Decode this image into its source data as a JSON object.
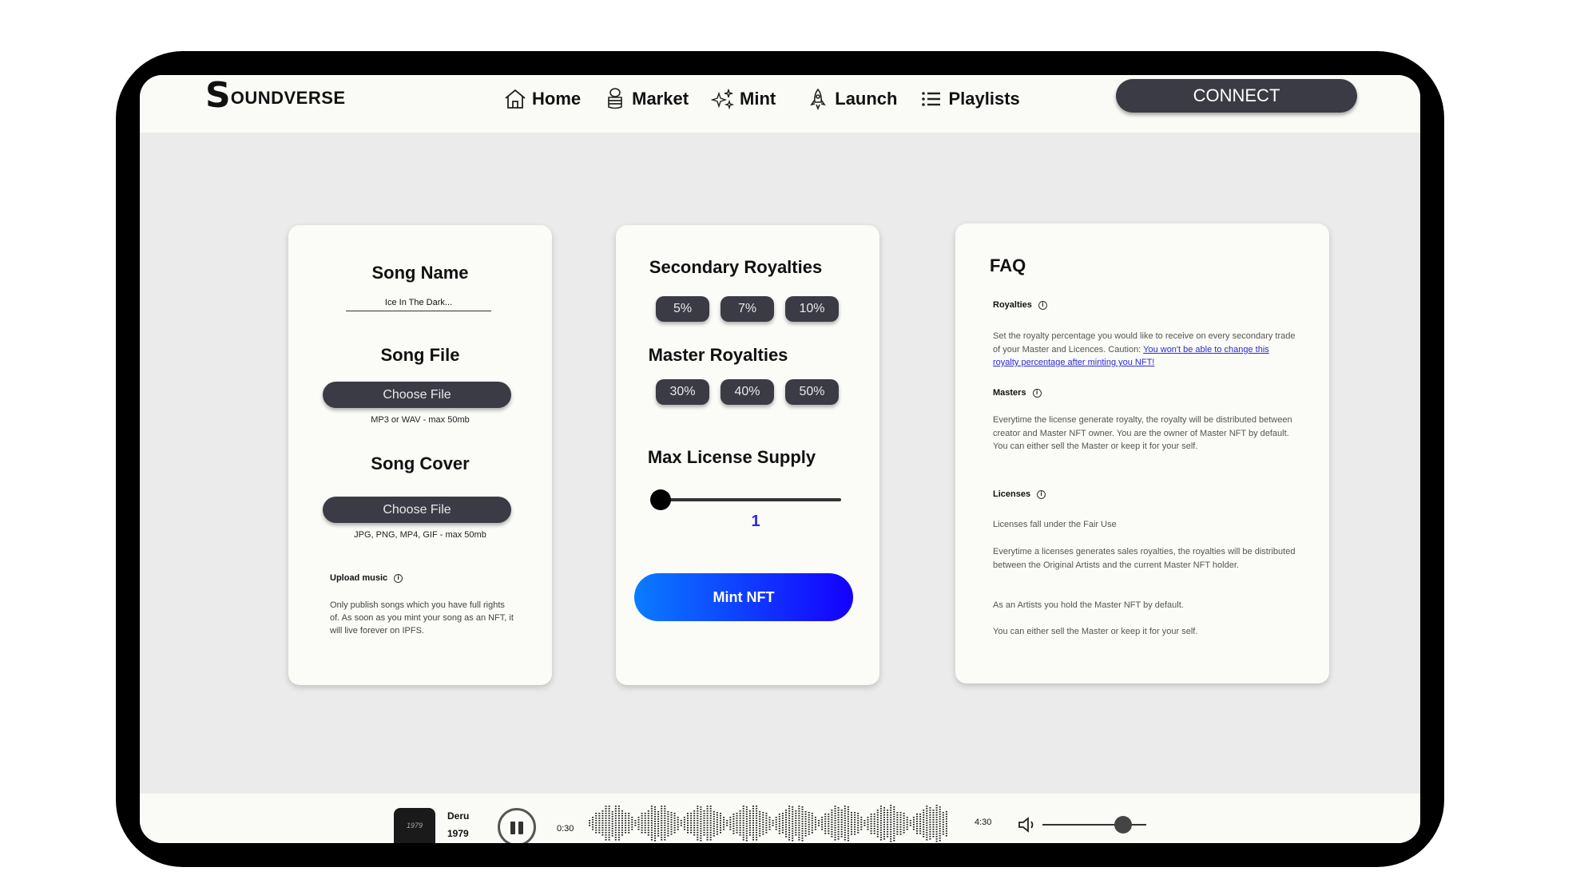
{
  "app": {
    "logo_s": "S",
    "logo_text": "OUNDVERSE"
  },
  "nav": {
    "items": [
      {
        "label": "Home",
        "icon": "home-icon"
      },
      {
        "label": "Market",
        "icon": "coins-icon"
      },
      {
        "label": "Mint",
        "icon": "sparkles-icon"
      },
      {
        "label": "Launch",
        "icon": "rocket-icon"
      },
      {
        "label": "Playlists",
        "icon": "list-icon"
      }
    ],
    "connect_label": "CONNECT"
  },
  "upload_card": {
    "song_name_title": "Song Name",
    "song_name_value": "Ice In The Dark...",
    "song_file_title": "Song File",
    "song_file_button": "Choose File",
    "song_file_hint": "MP3 or WAV - max 50mb",
    "song_cover_title": "Song Cover",
    "song_cover_button": "Choose File",
    "song_cover_hint": "JPG, PNG, MP4, GIF - max 50mb",
    "upload_title": "Upload music",
    "upload_text": "Only publish songs which you have full rights of. As soon as you mint your song as an NFT, it will live forever on IPFS."
  },
  "royalty_card": {
    "secondary_title": "Secondary Royalties",
    "secondary_options": [
      "5%",
      "7%",
      "10%"
    ],
    "master_title": "Master Royalties",
    "master_options": [
      "30%",
      "40%",
      "50%"
    ],
    "supply_title": "Max License Supply",
    "supply_value": "1",
    "supply_fraction": 0,
    "mint_label": "Mint NFT",
    "mint_gradient": [
      "#0a7cff",
      "#1400ff"
    ]
  },
  "faq": {
    "title": "FAQ",
    "royalties_title": "Royalties",
    "royalties_text": "Set the royalty percentage you would like to receive on every secondary trade of your Master and Licences. Caution: ",
    "royalties_link": "You won't be able to change this royalty percentage after minting you NFT!",
    "masters_title": "Masters",
    "masters_text": "Everytime the license generate royalty, the royalty will be distributed between creator and Master NFT owner. You are the owner of Master NFT by default. You can either sell the Master or keep it for your self.",
    "licenses_title": "Licenses",
    "licenses_p1": "Licenses fall under the Fair Use",
    "licenses_p2": "Everytime a licenses generates sales royalties, the royalties will be distributed between the Original Artists and the current Master NFT holder.",
    "licenses_p3": "As an Artists you hold the Master NFT by default.",
    "licenses_p4": "You can either sell the Master or keep it for your self."
  },
  "player": {
    "album_label": "1979",
    "artist": "Deru",
    "title": "1979",
    "time_current": "0:30",
    "time_total": "4:30",
    "volume_fraction": 0.78
  },
  "colors": {
    "dark_button": "#3b3b46",
    "accent_blue": "#2a2ad8"
  }
}
